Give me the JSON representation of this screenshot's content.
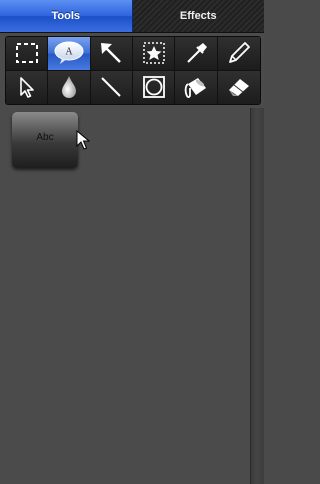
{
  "tabs": [
    {
      "label": "Tools",
      "active": true
    },
    {
      "label": "Effects",
      "active": false
    }
  ],
  "tools": [
    {
      "icon": "marquee-select-icon",
      "selected": false
    },
    {
      "icon": "text-bubble-icon",
      "selected": true,
      "glyph": "A"
    },
    {
      "icon": "arrow-icon",
      "selected": false
    },
    {
      "icon": "stamp-star-icon",
      "selected": false
    },
    {
      "icon": "eyedropper-icon",
      "selected": false
    },
    {
      "icon": "pencil-icon",
      "selected": false
    },
    {
      "icon": "pointer-icon",
      "selected": false
    },
    {
      "icon": "blur-drop-icon",
      "selected": false
    },
    {
      "icon": "line-icon",
      "selected": false
    },
    {
      "icon": "shape-frame-icon",
      "selected": false
    },
    {
      "icon": "paint-bucket-icon",
      "selected": false
    },
    {
      "icon": "eraser-icon",
      "selected": false
    }
  ],
  "canvas": {
    "text_item_label": "Abc"
  },
  "colors": {
    "accent": "#2e63dd",
    "background": "#4b4b4b"
  }
}
